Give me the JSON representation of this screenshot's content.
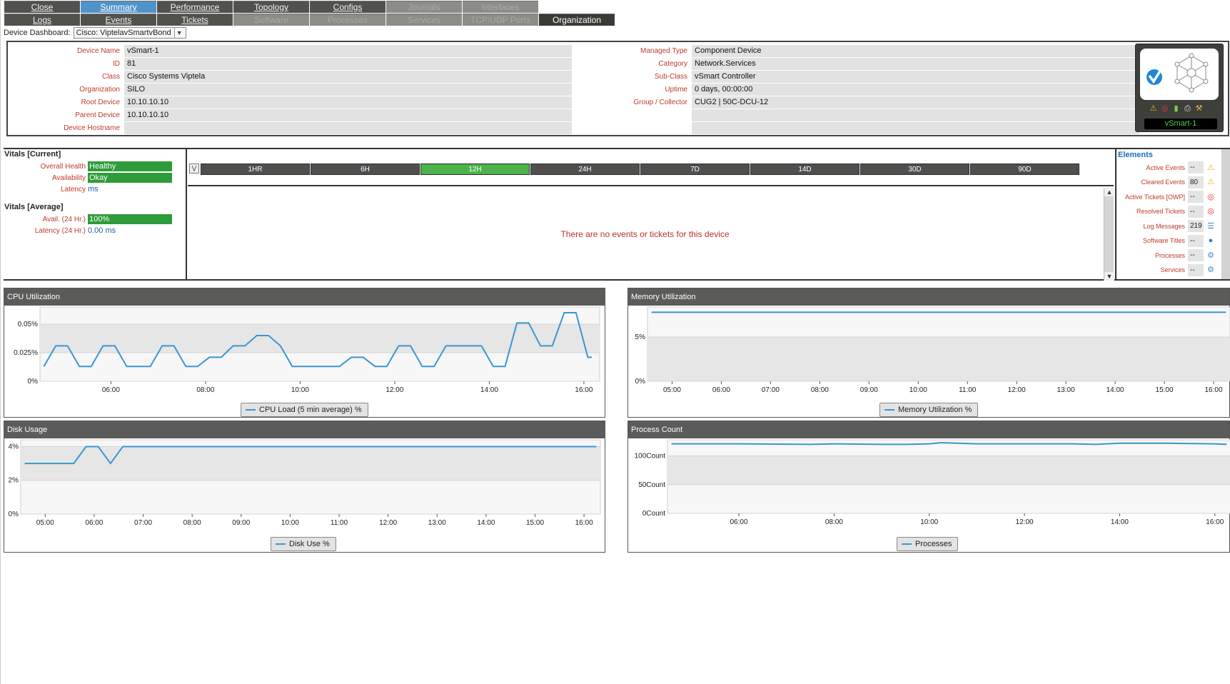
{
  "nav": {
    "row1": [
      {
        "label": "Close",
        "state": "normal"
      },
      {
        "label": "Summary",
        "state": "active"
      },
      {
        "label": "Performance",
        "state": "normal"
      },
      {
        "label": "Topology",
        "state": "normal"
      },
      {
        "label": "Configs",
        "state": "normal"
      },
      {
        "label": "Journals",
        "state": "disabled"
      },
      {
        "label": "Interfaces",
        "state": "disabled"
      }
    ],
    "row2": [
      {
        "label": "Logs",
        "state": "normal"
      },
      {
        "label": "Events",
        "state": "normal"
      },
      {
        "label": "Tickets",
        "state": "normal"
      },
      {
        "label": "Software",
        "state": "disabled"
      },
      {
        "label": "Processes",
        "state": "disabled"
      },
      {
        "label": "Services",
        "state": "disabled"
      },
      {
        "label": "TCP/UDP Ports",
        "state": "disabled"
      },
      {
        "label": "Organization",
        "state": "org"
      }
    ]
  },
  "dashboard": {
    "label": "Device Dashboard:",
    "value": "Cisco: ViptelavSmartvBond"
  },
  "device": {
    "left": [
      {
        "label": "Device Name",
        "value": "vSmart-1"
      },
      {
        "label": "ID",
        "value": "81"
      },
      {
        "label": "Class",
        "value": "Cisco Systems Viptela"
      },
      {
        "label": "Organization",
        "value": "SILO"
      },
      {
        "label": "Root Device",
        "value": "10.10.10.10"
      },
      {
        "label": "Parent Device",
        "value": "10.10.10.10"
      },
      {
        "label": "Device Hostname",
        "value": ""
      }
    ],
    "right": [
      {
        "label": "Managed Type",
        "value": "Component Device"
      },
      {
        "label": "Category",
        "value": "Network.Services"
      },
      {
        "label": "Sub-Class",
        "value": "vSmart Controller"
      },
      {
        "label": "Uptime",
        "value": "0 days, 00:00:00"
      },
      {
        "label": "Group / Collector",
        "value": "CUG2 | 50C-DCU-12"
      },
      {
        "label": "",
        "value": ""
      },
      {
        "label": "",
        "value": ""
      }
    ],
    "card_name": "vSmart-1"
  },
  "vitals": {
    "current_title": "Vitals [Current]",
    "overall_health_label": "Overall Health",
    "overall_health_value": "Healthy",
    "availability_label": "Availability",
    "availability_value": "Okay",
    "latency_label": "Latency",
    "latency_value": "ms",
    "average_title": "Vitals [Average]",
    "avail24_label": "Avail. (24 Hr.)",
    "avail24_value": "100%",
    "latency24_label": "Latency (24 Hr.)",
    "latency24_value": "0.00 ms"
  },
  "events": {
    "ranges": [
      "1HR",
      "6H",
      "12H",
      "24H",
      "7D",
      "14D",
      "30D",
      "90D"
    ],
    "active_range": "12H",
    "empty_message": "There are no events or tickets for this device"
  },
  "elements": {
    "title": "Elements",
    "items": [
      {
        "label": "Active Events",
        "value": "--",
        "icon": "warning-icon"
      },
      {
        "label": "Cleared Events",
        "value": "80",
        "icon": "warning-icon"
      },
      {
        "label": "Active Tickets [OWP]",
        "value": "--",
        "icon": "lifebuoy-icon"
      },
      {
        "label": "Resolved Tickets",
        "value": "--",
        "icon": "lifebuoy-icon"
      },
      {
        "label": "Log Messages",
        "value": "219",
        "icon": "document-icon"
      },
      {
        "label": "Software Titles",
        "value": "--",
        "icon": "globe-icon"
      },
      {
        "label": "Processes",
        "value": "--",
        "icon": "gear-icon"
      },
      {
        "label": "Services",
        "value": "--",
        "icon": "gear-icon"
      }
    ]
  },
  "colors": {
    "line": "#3a96d1",
    "active_tab": "#4f93cc",
    "active_range": "#4cb34a",
    "health_bar": "#2e9c3a"
  },
  "chart_data": [
    {
      "title": "CPU Utilization",
      "type": "line",
      "legend": "CPU Load (5 min average) %",
      "y_ticks": [
        "0.05%",
        "0.025%",
        "0%"
      ],
      "ylim": [
        0,
        0.065
      ],
      "x_ticks": [
        "06:00",
        "08:00",
        "10:00",
        "12:00",
        "14:00",
        "16:00"
      ],
      "x_range": [
        "04:30",
        "16:20"
      ],
      "series": [
        {
          "x": [
            "04:35",
            "04:50",
            "05:05",
            "05:20",
            "05:35",
            "05:50",
            "06:05",
            "06:20",
            "06:35",
            "06:50",
            "07:05",
            "07:20",
            "07:35",
            "07:50",
            "08:05",
            "08:20",
            "08:35",
            "08:50",
            "09:05",
            "09:20",
            "09:35",
            "09:50",
            "10:05",
            "10:20",
            "10:35",
            "10:50",
            "11:05",
            "11:20",
            "11:35",
            "11:50",
            "12:05",
            "12:20",
            "12:35",
            "12:50",
            "13:05",
            "13:20",
            "13:35",
            "13:50",
            "14:05",
            "14:20",
            "14:35",
            "14:50",
            "15:05",
            "15:20",
            "15:35",
            "15:50",
            "16:05",
            "16:10"
          ],
          "values": [
            0.013,
            0.031,
            0.031,
            0.013,
            0.013,
            0.031,
            0.031,
            0.013,
            0.013,
            0.013,
            0.031,
            0.031,
            0.013,
            0.013,
            0.021,
            0.021,
            0.031,
            0.031,
            0.04,
            0.04,
            0.031,
            0.013,
            0.013,
            0.013,
            0.013,
            0.013,
            0.021,
            0.021,
            0.013,
            0.013,
            0.031,
            0.031,
            0.013,
            0.013,
            0.031,
            0.031,
            0.031,
            0.031,
            0.013,
            0.013,
            0.051,
            0.051,
            0.031,
            0.031,
            0.06,
            0.06,
            0.021,
            0.021
          ]
        }
      ]
    },
    {
      "title": "Memory Utilization",
      "type": "line",
      "legend": "Memory Utilization %",
      "y_ticks": [
        "5%",
        "0%"
      ],
      "ylim": [
        0,
        8.4
      ],
      "x_ticks": [
        "05:00",
        "06:00",
        "07:00",
        "08:00",
        "09:00",
        "10:00",
        "11:00",
        "12:00",
        "13:00",
        "14:00",
        "15:00",
        "16:00"
      ],
      "x_range": [
        "04:30",
        "16:20"
      ],
      "series": [
        {
          "x": [
            "04:35",
            "16:15"
          ],
          "values": [
            7.8,
            7.8
          ]
        }
      ]
    },
    {
      "title": "Disk Usage",
      "type": "line",
      "legend": "Disk Use %",
      "y_ticks": [
        "4%",
        "2%",
        "0%"
      ],
      "ylim": [
        0,
        4.4
      ],
      "x_ticks": [
        "05:00",
        "06:00",
        "07:00",
        "08:00",
        "09:00",
        "10:00",
        "11:00",
        "12:00",
        "13:00",
        "14:00",
        "15:00",
        "16:00"
      ],
      "x_range": [
        "04:30",
        "16:20"
      ],
      "series": [
        {
          "x": [
            "04:35",
            "05:35",
            "05:50",
            "06:05",
            "06:20",
            "06:35",
            "16:15"
          ],
          "values": [
            3.0,
            3.0,
            4.0,
            4.0,
            3.0,
            4.0,
            4.0
          ]
        }
      ]
    },
    {
      "title": "Process Count",
      "type": "line",
      "legend": "Processes",
      "y_ticks": [
        "100Count",
        "50Count",
        "0Count"
      ],
      "ylim": [
        0,
        128
      ],
      "x_ticks": [
        "06:00",
        "08:00",
        "10:00",
        "12:00",
        "14:00",
        "16:00"
      ],
      "x_range": [
        "04:30",
        "16:20"
      ],
      "series": [
        {
          "x": [
            "04:35",
            "06:00",
            "07:30",
            "08:00",
            "09:00",
            "09:30",
            "10:00",
            "10:15",
            "11:00",
            "12:00",
            "13:00",
            "13:30",
            "14:00",
            "15:00",
            "16:00",
            "16:15"
          ],
          "values": [
            121,
            121,
            120,
            121,
            120,
            120,
            121,
            123,
            121,
            121,
            121,
            120,
            122,
            122,
            121,
            120
          ]
        }
      ]
    }
  ]
}
